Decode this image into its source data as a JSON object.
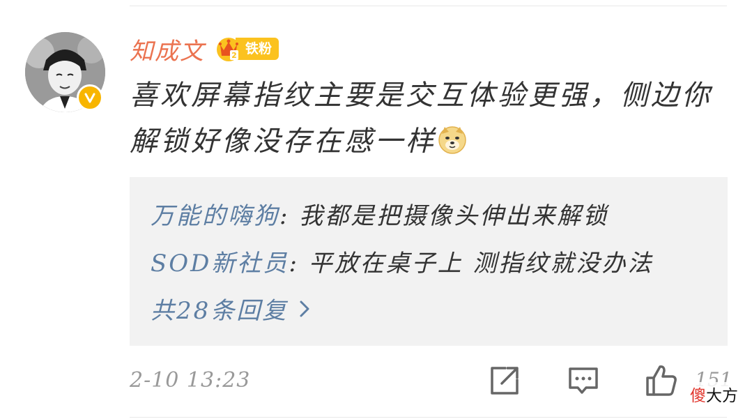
{
  "comment": {
    "author": "知成文",
    "fan_badge": "铁粉",
    "fan_badge_level": "2",
    "text": "喜欢屏幕指纹主要是交互体验更强，侧边你解锁好像没存在感一样",
    "emoji": "doge-icon",
    "timestamp": "2-10 13:23",
    "like_count": "151"
  },
  "replies": [
    {
      "user": "万能的嗨狗",
      "separator": ": ",
      "text": "我都是把摄像头伸出来解锁"
    },
    {
      "user": "SOD新社员",
      "separator": ": ",
      "text": "平放在桌子上 测指纹就没办法"
    }
  ],
  "more_replies": "共28条回复",
  "watermark": {
    "part1": "傻",
    "part2": "大方"
  },
  "colors": {
    "author": "#eb7350",
    "link": "#5d7ea3",
    "badge": "#fbc21f",
    "verified": "#f8b500",
    "reply_bg": "#f2f2f2",
    "meta": "#999999"
  }
}
